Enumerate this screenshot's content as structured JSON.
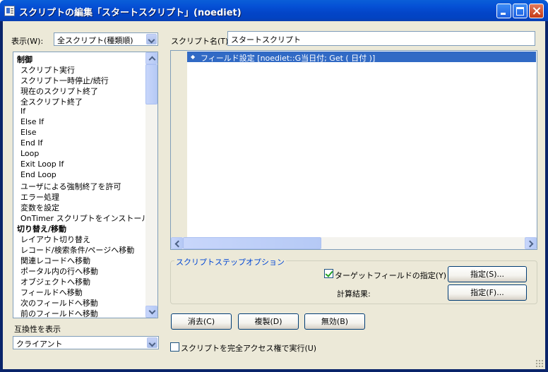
{
  "window": {
    "title": "スクリプトの編集「スタートスクリプト」(noediet)"
  },
  "view": {
    "label": "表示(W):",
    "selected": "全スクリプト(種類順)"
  },
  "script_name": {
    "label": "スクリプト名(T):",
    "value": "スタートスクリプト"
  },
  "steps_list": [
    {
      "label": "制御",
      "category": true
    },
    {
      "label": "スクリプト実行"
    },
    {
      "label": "スクリプト一時停止/続行"
    },
    {
      "label": "現在のスクリプト終了"
    },
    {
      "label": "全スクリプト終了"
    },
    {
      "label": "If"
    },
    {
      "label": "Else If"
    },
    {
      "label": "Else"
    },
    {
      "label": "End If"
    },
    {
      "label": "Loop"
    },
    {
      "label": "Exit Loop If"
    },
    {
      "label": "End Loop"
    },
    {
      "label": "ユーザによる強制終了を許可"
    },
    {
      "label": "エラー処理"
    },
    {
      "label": "変数を設定"
    },
    {
      "label": "OnTimer スクリプトをインストール"
    },
    {
      "label": "切り替え/移動",
      "category": true
    },
    {
      "label": "レイアウト切り替え"
    },
    {
      "label": "レコード/検索条件/ページへ移動"
    },
    {
      "label": "関連レコードへ移動"
    },
    {
      "label": "ポータル内の行へ移動"
    },
    {
      "label": "オブジェクトへ移動"
    },
    {
      "label": "フィールドへ移動"
    },
    {
      "label": "次のフィールドへ移動"
    },
    {
      "label": "前のフィールドへ移動"
    }
  ],
  "compat": {
    "label": "互換性を表示",
    "selected": "クライアント"
  },
  "script_steps": [
    {
      "text": "フィールド設定 [noediet::G当日付; Get ( 日付 )]",
      "selected": true
    }
  ],
  "options": {
    "title": "スクリプトステップオプション",
    "target_label": "ターゲットフィールドの指定(Y)",
    "target_checked": true,
    "specify_s_label": "指定(S)...",
    "calc_label": "計算結果:",
    "specify_f_label": "指定(F)..."
  },
  "buttons": {
    "clear": "消去(C)",
    "duplicate": "複製(D)",
    "disable": "無効(B)"
  },
  "full_access": {
    "label": "スクリプトを完全アクセス権で実行(U)",
    "checked": false
  }
}
